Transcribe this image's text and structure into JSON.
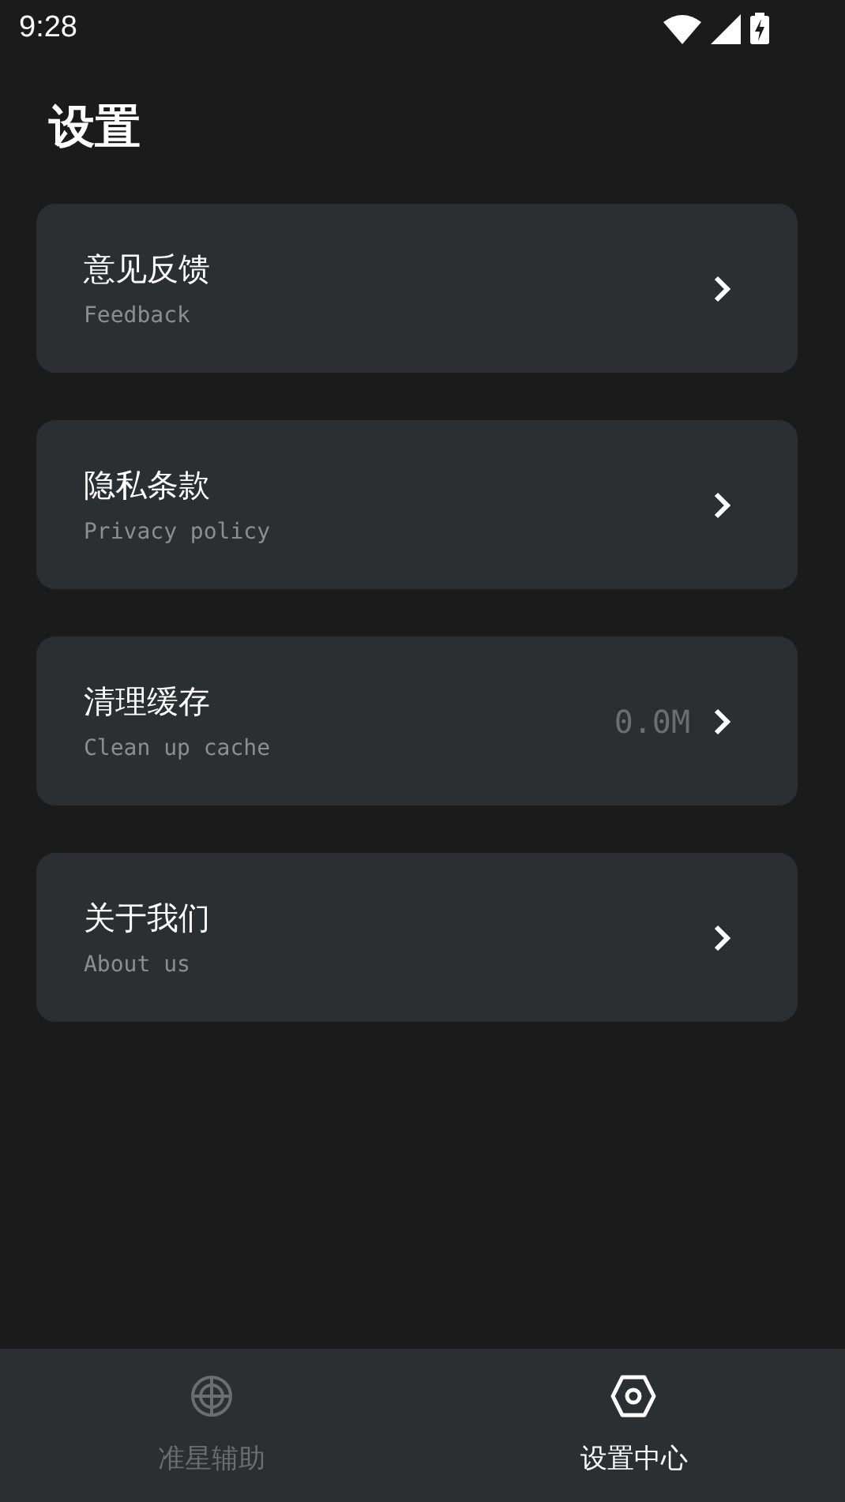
{
  "status_bar": {
    "time": "9:28"
  },
  "title": "设置",
  "items": [
    {
      "title": "意见反馈",
      "subtitle": "Feedback"
    },
    {
      "title": "隐私条款",
      "subtitle": "Privacy policy"
    },
    {
      "title": "清理缓存",
      "subtitle": "Clean up cache",
      "value": "0.0M"
    },
    {
      "title": "关于我们",
      "subtitle": "About us"
    }
  ],
  "tabs": [
    {
      "label": "准星辅助",
      "kind": "crosshair",
      "selected": false
    },
    {
      "label": "设置中心",
      "kind": "hexagon",
      "selected": true
    }
  ]
}
